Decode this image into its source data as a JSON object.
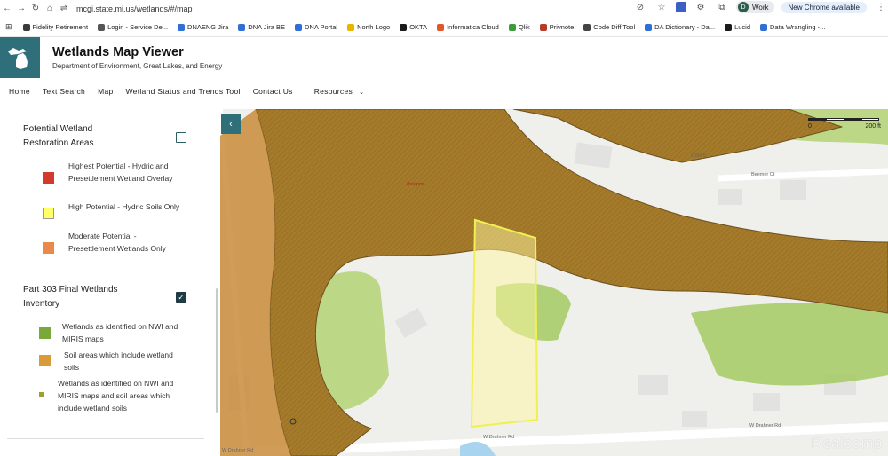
{
  "browser": {
    "url": "mcgi.state.mi.us/wetlands/#/map",
    "profile_name": "Work",
    "profile_initial": "D",
    "update_label": "New Chrome available"
  },
  "bookmarks": [
    {
      "label": "Fidelity Retirement",
      "color": "#3a3a3a"
    },
    {
      "label": "Login - Service De...",
      "color": "#555555"
    },
    {
      "label": "DNAENG Jira",
      "color": "#2f6fd6"
    },
    {
      "label": "DNA Jira BE",
      "color": "#2f6fd6"
    },
    {
      "label": "DNA Portal",
      "color": "#2f6fd6"
    },
    {
      "label": "North Logo",
      "color": "#e8b400"
    },
    {
      "label": "OKTA",
      "color": "#1b1b1b"
    },
    {
      "label": "Informatica Cloud",
      "color": "#e0582a"
    },
    {
      "label": "Qlik",
      "color": "#3a9d3a"
    },
    {
      "label": "Privnote",
      "color": "#b83a2a"
    },
    {
      "label": "Code Diff Tool",
      "color": "#444444"
    },
    {
      "label": "DA Dictionary - Da...",
      "color": "#2f6fd6"
    },
    {
      "label": "Lucid",
      "color": "#1b1b1b"
    },
    {
      "label": "Data Wrangling -...",
      "color": "#2f6fd6"
    }
  ],
  "site": {
    "title": "Wetlands Map Viewer",
    "subtitle": "Department of Environment, Great Lakes, and Energy"
  },
  "nav": [
    "Home",
    "Text Search",
    "Map",
    "Wetland Status and Trends Tool",
    "Contact Us",
    "Resources"
  ],
  "panel": {
    "section1": {
      "title": "Potential Wetland Restoration Areas",
      "checked": false,
      "items": [
        {
          "label": "Highest Potential - Hydric and Presettlement Wetland Overlay",
          "color": "#d23b2b"
        },
        {
          "label": "High Potential - Hydric Soils Only",
          "color": "#ffff66"
        },
        {
          "label": "Moderate Potential - Presettlement Wetlands Only",
          "color": "#e98a4a"
        }
      ]
    },
    "section2": {
      "title": "Part 303 Final Wetlands Inventory",
      "checked": true,
      "checkmark": "✓",
      "items": [
        {
          "label": "Wetlands as identified on NWI and MIRIS maps",
          "color": "#7aa83a"
        },
        {
          "label": "Soil areas which include wetland soils",
          "color": "#d99a3a"
        },
        {
          "label": "Wetlands as identified on NWI and MIRIS maps and soil areas which include wetland soils",
          "color": "#a0a030"
        }
      ]
    }
  },
  "map": {
    "collapse_glyph": "‹",
    "scale_start": "0",
    "scale_end": "200 ft",
    "street_labels": [
      "Beemer Ct",
      "W Drahner Rd",
      "W Drahner Rd",
      "W Drahner Rd"
    ],
    "address_label": "1034 ft",
    "parcel_label": "(hoapm)",
    "watermark": "Realcomp"
  }
}
